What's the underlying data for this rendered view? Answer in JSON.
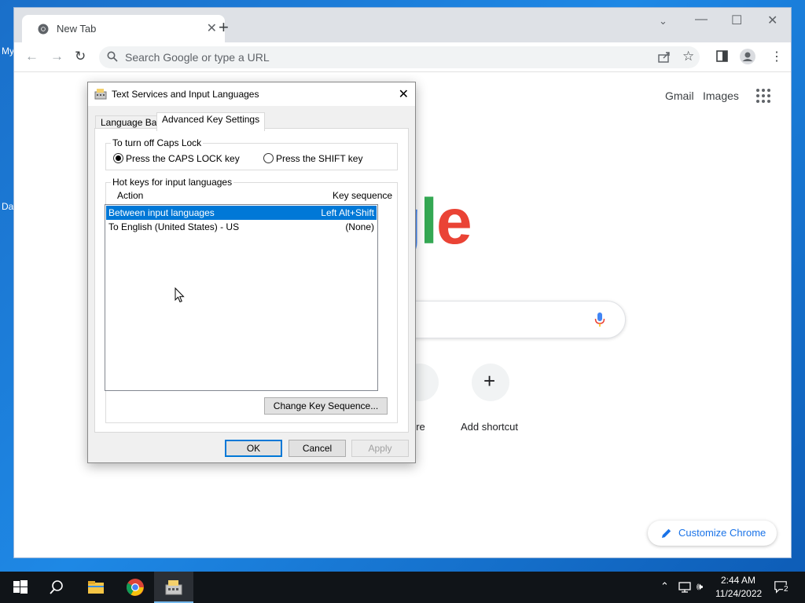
{
  "desktop": {
    "labels": [
      "My",
      "Da"
    ]
  },
  "browser": {
    "tab_title": "New Tab",
    "omnibox_placeholder": "Search Google or type a URL",
    "new_tab_page": {
      "links": [
        "Gmail",
        "Images"
      ],
      "logo_text": "ogle",
      "shortcuts": [
        {
          "label": "ore"
        },
        {
          "label": "Add shortcut",
          "icon": "plus-icon"
        }
      ],
      "customize_label": "Customize Chrome"
    }
  },
  "dialog": {
    "title": "Text Services and Input Languages",
    "tabs": [
      {
        "label": "Language Bar",
        "active": false
      },
      {
        "label": "Advanced Key Settings",
        "active": true
      }
    ],
    "caps_lock_group": {
      "legend": "To turn off Caps Lock",
      "options": [
        {
          "label": "Press the CAPS LOCK key",
          "checked": true
        },
        {
          "label": "Press the SHIFT key",
          "checked": false
        }
      ]
    },
    "hotkeys_group": {
      "legend": "Hot keys for input languages",
      "col_action": "Action",
      "col_key": "Key sequence",
      "rows": [
        {
          "action": "Between input languages",
          "key": "Left Alt+Shift",
          "selected": true
        },
        {
          "action": "To English (United States) - US",
          "key": "(None)",
          "selected": false
        }
      ],
      "change_button": "Change Key Sequence..."
    },
    "buttons": {
      "ok": "OK",
      "cancel": "Cancel",
      "apply": "Apply"
    }
  },
  "taskbar": {
    "time": "2:44 AM",
    "date": "11/24/2022",
    "notification_count": "2"
  },
  "colors": {
    "accent": "#0078d7",
    "google_blue": "#4285f4",
    "google_red": "#ea4335",
    "google_yellow": "#fbbc05",
    "google_green": "#34a853"
  }
}
